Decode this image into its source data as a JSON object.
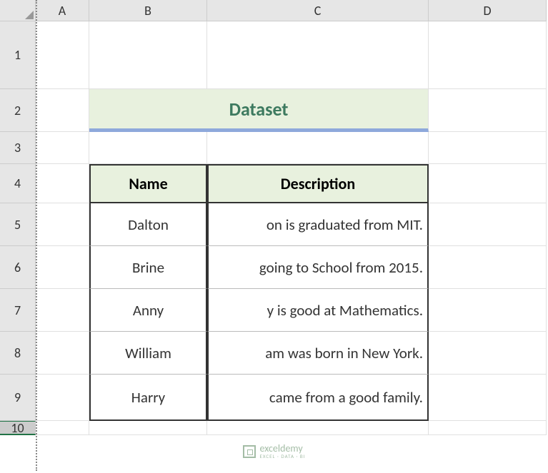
{
  "columns": [
    "A",
    "B",
    "C",
    "D"
  ],
  "rows": [
    "1",
    "2",
    "3",
    "4",
    "5",
    "6",
    "7",
    "8",
    "9",
    "10"
  ],
  "title": "Dataset",
  "headers": {
    "name": "Name",
    "description": "Description"
  },
  "data": [
    {
      "name": "Dalton",
      "desc_visible": "on is graduated from MIT."
    },
    {
      "name": "Brine",
      "desc_visible": "going to School from 2015."
    },
    {
      "name": "Anny",
      "desc_visible": "y is good at Mathematics."
    },
    {
      "name": "William",
      "desc_visible": "am was born in New York."
    },
    {
      "name": "Harry",
      "desc_visible": "came from a good family."
    }
  ],
  "selected_row": "10",
  "watermark": {
    "brand": "exceldemy",
    "tagline": "EXCEL · DATA · BI"
  }
}
